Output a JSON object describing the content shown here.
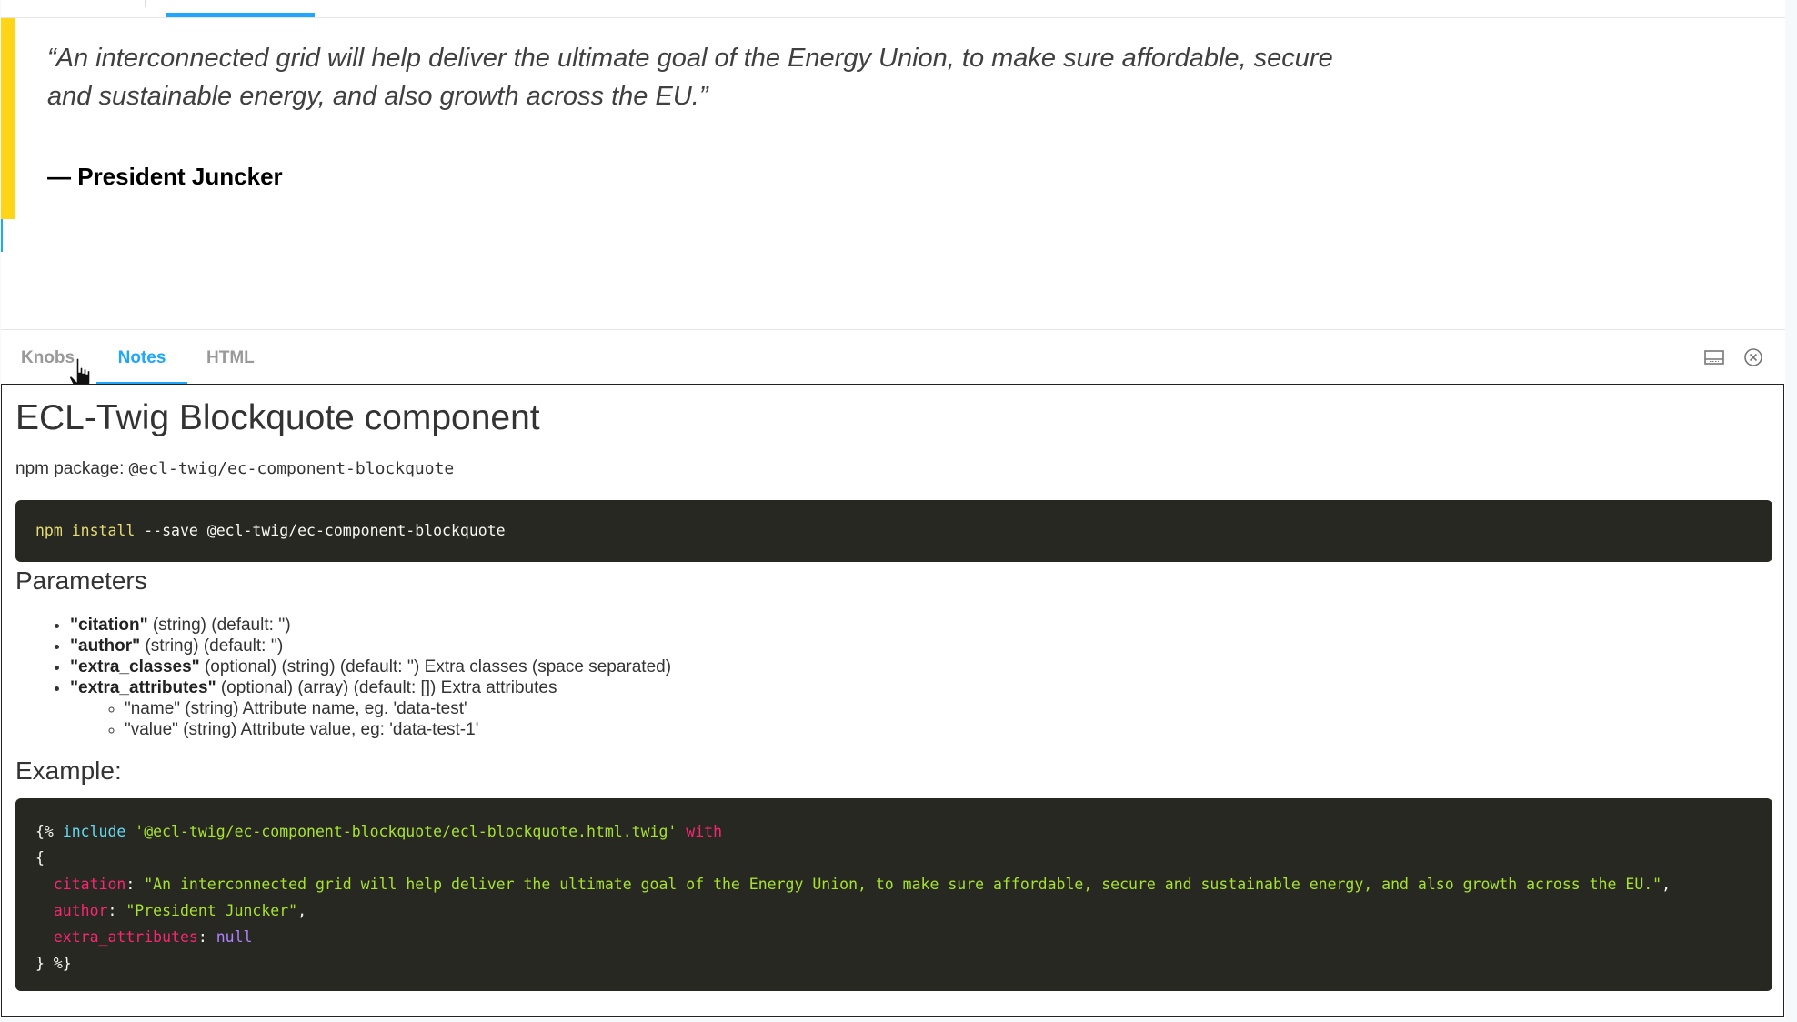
{
  "preview": {
    "quote": "“An interconnected grid will help deliver the ultimate goal of the Energy Union, to make sure affordable, secure and sustainable energy, and also growth across the EU.”",
    "author": "— President Juncker",
    "colors": {
      "accent_bar": "#ffd617",
      "tab_active": "#1ea7fd"
    }
  },
  "panel": {
    "tabs": [
      {
        "label": "Knobs"
      },
      {
        "label": "Notes"
      },
      {
        "label": "HTML"
      }
    ],
    "active_tab": "Notes",
    "buttons": {
      "layout_icon": "panel-layout-icon",
      "close_icon": "close-circle-icon"
    }
  },
  "notes": {
    "title": "ECL-Twig Blockquote component",
    "npm_label": "npm package:",
    "npm_package": "@ecl-twig/ec-component-blockquote",
    "install_cmd": {
      "npm": "npm",
      "install": "install",
      "rest": " --save @ecl-twig/ec-component-blockquote"
    },
    "params_heading": "Parameters",
    "params": [
      {
        "name": "\"citation\"",
        "desc": " (string) (default: '')"
      },
      {
        "name": "\"author\"",
        "desc": " (string) (default: '')"
      },
      {
        "name": "\"extra_classes\"",
        "desc": " (optional) (string) (default: '') Extra classes (space separated)"
      },
      {
        "name": "\"extra_attributes\"",
        "desc": " (optional) (array) (default: []) Extra attributes"
      }
    ],
    "sub_params": [
      "\"name\" (string) Attribute name, eg. 'data-test'",
      "\"value\" (string) Attribute value, eg: 'data-test-1'"
    ],
    "example_heading": "Example:",
    "example": {
      "l1_open": "{%",
      "l1_include": "include",
      "l1_path": "'@ecl-twig/ec-component-blockquote/ecl-blockquote.html.twig'",
      "l1_with": "with",
      "l2": "{",
      "citation_key": "citation",
      "citation_val": "\"An interconnected grid will help deliver the ultimate goal of the Energy Union, to make sure affordable, secure and sustainable energy, and also growth across the EU.\"",
      "author_key": "author",
      "author_val": "\"President Juncker\"",
      "extra_key": "extra_attributes",
      "extra_val": "null",
      "l_close": "} %}"
    }
  }
}
